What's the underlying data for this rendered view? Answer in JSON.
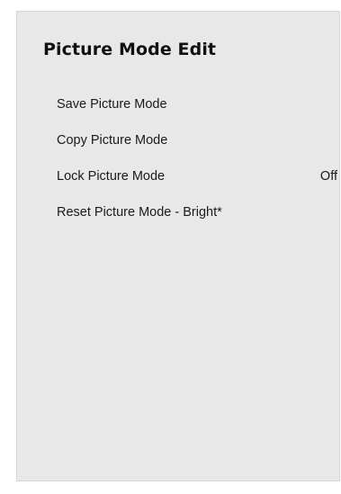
{
  "panel": {
    "title": "Picture Mode Edit"
  },
  "menu": {
    "items": [
      {
        "label": "Save Picture Mode"
      },
      {
        "label": "Copy Picture Mode"
      },
      {
        "label": "Lock Picture Mode",
        "value": "Off"
      },
      {
        "label": "Reset Picture Mode - Bright*"
      }
    ]
  }
}
